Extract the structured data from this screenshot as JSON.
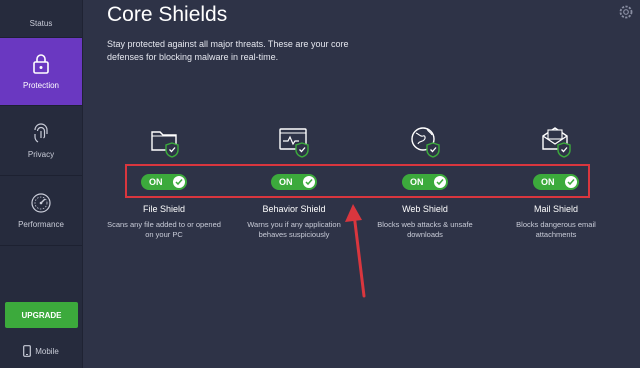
{
  "sidebar": {
    "items": [
      {
        "label": "Status",
        "icon": "status-shield-icon"
      },
      {
        "label": "Protection",
        "icon": "lock-icon"
      },
      {
        "label": "Privacy",
        "icon": "fingerprint-icon"
      },
      {
        "label": "Performance",
        "icon": "speedometer-icon"
      }
    ],
    "upgrade_label": "UPGRADE",
    "mobile_label": "Mobile"
  },
  "main": {
    "title": "Core Shields",
    "description": "Stay protected against all major threats. These are your core defenses for blocking malware in real-time.",
    "shields": [
      {
        "name": "File Shield",
        "status": "ON",
        "desc": "Scans any file added to or opened on your PC",
        "icon": "folder-shield-icon"
      },
      {
        "name": "Behavior Shield",
        "status": "ON",
        "desc": "Warns you if any application behaves suspiciously",
        "icon": "monitor-shield-icon"
      },
      {
        "name": "Web Shield",
        "status": "ON",
        "desc": "Blocks web attacks & unsafe downloads",
        "icon": "globe-shield-icon"
      },
      {
        "name": "Mail Shield",
        "status": "ON",
        "desc": "Blocks dangerous email attachments",
        "icon": "mail-shield-icon"
      }
    ]
  },
  "colors": {
    "accent_purple": "#6a38c1",
    "on_green": "#3caa3c",
    "highlight_red": "#d9363e",
    "background": "#2e3347"
  }
}
